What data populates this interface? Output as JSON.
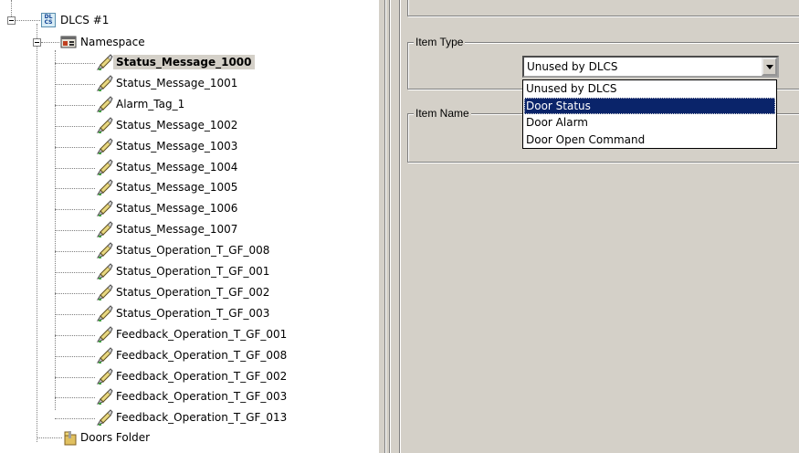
{
  "tree": {
    "root": {
      "label": "DLCS #1",
      "icon": "dlcs-icon",
      "icon_text": "DL CS"
    },
    "namespace": {
      "label": "Namespace",
      "icon": "namespace-icon"
    },
    "items": [
      "Status_Message_1000",
      "Status_Message_1001",
      "Alarm_Tag_1",
      "Status_Message_1002",
      "Status_Message_1003",
      "Status_Message_1004",
      "Status_Message_1005",
      "Status_Message_1006",
      "Status_Message_1007",
      "Status_Operation_T_GF_008",
      "Status_Operation_T_GF_001",
      "Status_Operation_T_GF_002",
      "Status_Operation_T_GF_003",
      "Feedback_Operation_T_GF_001",
      "Feedback_Operation_T_GF_008",
      "Feedback_Operation_T_GF_002",
      "Feedback_Operation_T_GF_003",
      "Feedback_Operation_T_GF_013"
    ],
    "selected_item": "Status_Message_1000",
    "folder": {
      "label": "Doors Folder",
      "icon": "folder-icon"
    }
  },
  "panel": {
    "item_type": {
      "title": "Item Type",
      "value": "Unused by DLCS",
      "options": [
        "Unused by DLCS",
        "Door Status",
        "Door Alarm",
        "Door Open Command"
      ],
      "highlighted": "Door Status"
    },
    "item_name": {
      "title": "Item Name"
    }
  },
  "colors": {
    "panel_bg": "#d4d0c8",
    "selection": "#0a246a"
  }
}
